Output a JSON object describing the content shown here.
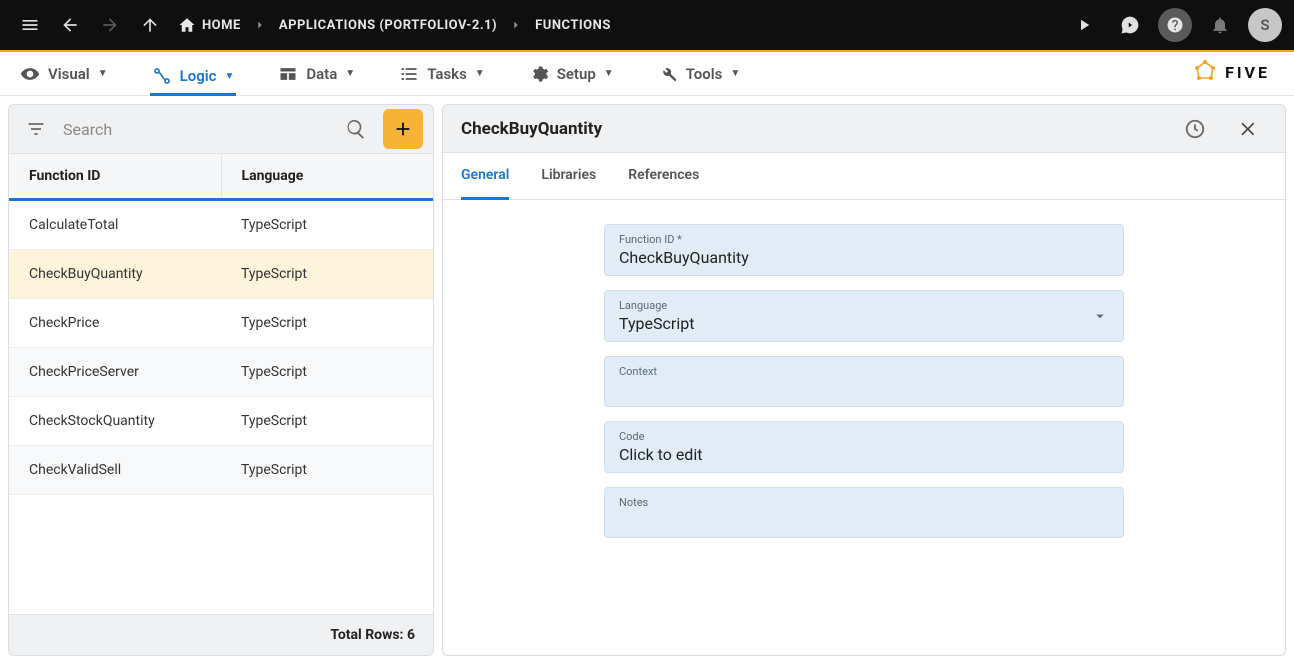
{
  "topbar": {
    "breadcrumb": {
      "home": "HOME",
      "app": "APPLICATIONS (PORTFOLIOV-2.1)",
      "section": "FUNCTIONS"
    },
    "avatar_letter": "S"
  },
  "nav": {
    "visual": "Visual",
    "logic": "Logic",
    "data": "Data",
    "tasks": "Tasks",
    "setup": "Setup",
    "tools": "Tools",
    "brand": "FIVE"
  },
  "list": {
    "search_placeholder": "Search",
    "columns": {
      "id": "Function ID",
      "lang": "Language"
    },
    "rows": [
      {
        "id": "CalculateTotal",
        "lang": "TypeScript",
        "selected": false
      },
      {
        "id": "CheckBuyQuantity",
        "lang": "TypeScript",
        "selected": true
      },
      {
        "id": "CheckPrice",
        "lang": "TypeScript",
        "selected": false
      },
      {
        "id": "CheckPriceServer",
        "lang": "TypeScript",
        "selected": false
      },
      {
        "id": "CheckStockQuantity",
        "lang": "TypeScript",
        "selected": false
      },
      {
        "id": "CheckValidSell",
        "lang": "TypeScript",
        "selected": false
      }
    ],
    "footer": "Total Rows: 6"
  },
  "detail": {
    "title": "CheckBuyQuantity",
    "tabs": {
      "general": "General",
      "libraries": "Libraries",
      "references": "References"
    },
    "fields": {
      "function_id": {
        "label": "Function ID *",
        "value": "CheckBuyQuantity"
      },
      "language": {
        "label": "Language",
        "value": "TypeScript"
      },
      "context": {
        "label": "Context",
        "value": ""
      },
      "code": {
        "label": "Code",
        "value": "Click to edit"
      },
      "notes": {
        "label": "Notes",
        "value": ""
      }
    }
  }
}
